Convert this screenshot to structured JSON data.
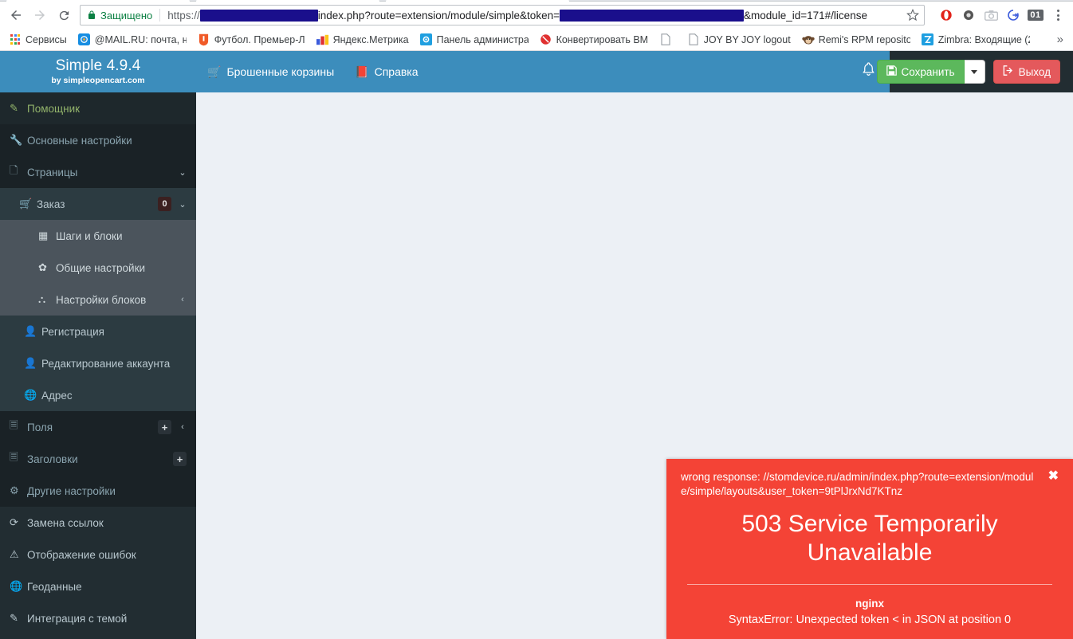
{
  "browser": {
    "nav": {
      "back": "back-arrow",
      "forward": "forward-arrow",
      "reload": "reload"
    },
    "omnibox": {
      "secure_label": "Защищено",
      "url_scheme": "https://",
      "url_path": "index.php?route=extension/module/simple&token=",
      "url_tail": "&module_id=171#/license",
      "redacted_host": true,
      "redacted_token": true
    },
    "extensions": [
      {
        "name": "opera-shield-icon",
        "badge": ""
      },
      {
        "name": "dark-gear-icon",
        "badge": ""
      },
      {
        "name": "camera-icon",
        "badge": ""
      },
      {
        "name": "blue-arrow-circle-icon",
        "badge": ""
      },
      {
        "name": "counter-badge-icon",
        "badge": "01"
      }
    ],
    "menu_label": "kebab-menu",
    "bookmarks": [
      {
        "label": "Сервисы",
        "icon": "apps-grid-icon"
      },
      {
        "label": "@MAIL.RU: почта, нс",
        "icon": "mailru-icon"
      },
      {
        "label": "Футбол. Премьер-Л",
        "icon": "championat-icon"
      },
      {
        "label": "Яндекс.Метрика",
        "icon": "metrika-icon"
      },
      {
        "label": "Панель администрат",
        "icon": "gear-blue-icon"
      },
      {
        "label": "Конвертировать BM",
        "icon": "red-circle-icon"
      },
      {
        "label": "",
        "icon": "page-icon"
      },
      {
        "label": "JOY BY JOY logout",
        "icon": "page-icon"
      },
      {
        "label": "Remi's RPM repositor",
        "icon": "monkey-icon"
      },
      {
        "label": "Zimbra: Входящие (2",
        "icon": "zimbra-icon"
      }
    ],
    "overflow_label": "»"
  },
  "sidebar": {
    "brand": {
      "title": "Simple 4.9.4",
      "subtitle": "by simpleopencart.com"
    },
    "items": [
      {
        "label": "Помощник",
        "icon": "magic-wand-icon",
        "level": "helper",
        "badge": "",
        "chevron": ""
      },
      {
        "label": "Основные настройки",
        "icon": "wrench-icon",
        "level": "section-head",
        "badge": "",
        "chevron": ""
      },
      {
        "label": "Страницы",
        "icon": "page-icon",
        "level": "section-head",
        "badge": "",
        "chevron": "down"
      },
      {
        "label": "Заказ",
        "icon": "cart-icon",
        "level": "lvl1",
        "badge": "0",
        "chevron": "down"
      },
      {
        "label": "Шаги и блоки",
        "icon": "blocks-icon",
        "level": "lvl2",
        "badge": "",
        "chevron": ""
      },
      {
        "label": "Общие настройки",
        "icon": "gear-icon",
        "level": "lvl2",
        "badge": "",
        "chevron": ""
      },
      {
        "label": "Настройки блоков",
        "icon": "sitemap-icon",
        "level": "lvl2",
        "badge": "",
        "chevron": "left"
      },
      {
        "label": "Регистрация",
        "icon": "user-plus-icon",
        "level": "lvl1-sub",
        "badge": "",
        "chevron": ""
      },
      {
        "label": "Редактирование аккаунта",
        "icon": "user-icon",
        "level": "lvl1-sub",
        "badge": "",
        "chevron": ""
      },
      {
        "label": "Адрес",
        "icon": "globe-icon",
        "level": "lvl1-sub",
        "badge": "",
        "chevron": ""
      },
      {
        "label": "Поля",
        "icon": "file-text-icon",
        "level": "section-head",
        "badge": "+",
        "chevron": "left"
      },
      {
        "label": "Заголовки",
        "icon": "file-text-icon",
        "level": "section-head",
        "badge": "+",
        "chevron": ""
      },
      {
        "label": "Другие настройки",
        "icon": "gears-icon",
        "level": "section-head",
        "badge": "",
        "chevron": ""
      },
      {
        "label": "Замена ссылок",
        "icon": "refresh-icon",
        "level": "plain",
        "badge": "",
        "chevron": ""
      },
      {
        "label": "Отображение ошибок",
        "icon": "warning-icon",
        "level": "plain",
        "badge": "",
        "chevron": ""
      },
      {
        "label": "Геоданные",
        "icon": "globe-icon",
        "level": "plain",
        "badge": "",
        "chevron": ""
      },
      {
        "label": "Интеграция с темой",
        "icon": "magic-wand-icon",
        "level": "plain",
        "badge": "",
        "chevron": ""
      }
    ]
  },
  "topbar": {
    "nav": [
      {
        "label": "Брошенные корзины",
        "icon": "cart-icon"
      },
      {
        "label": "Справка",
        "icon": "book-icon"
      }
    ],
    "bell_icon": "bell-icon",
    "save_label": "Сохранить",
    "save_icon": "floppy-disk-icon",
    "save_caret": "chevron-down-icon",
    "exit_label": "Выход",
    "exit_icon": "sign-out-icon"
  },
  "error_toast": {
    "message": "wrong response: //stomdevice.ru/admin/index.php?route=extension/module/simple/layouts&user_token=9tPlJrxNd7KTnz",
    "close_icon": "✖",
    "title": "503 Service Temporarily Unavailable",
    "server": "nginx",
    "syntax_error": "SyntaxError: Unexpected token < in JSON at position 0"
  },
  "colors": {
    "header_blue": "#3c8dbc",
    "sidebar_dark": "#222d32",
    "content_bg": "#ecf0f5",
    "error_red": "#f44336",
    "save_green": "#5cb85c",
    "exit_red": "#e4595c"
  }
}
